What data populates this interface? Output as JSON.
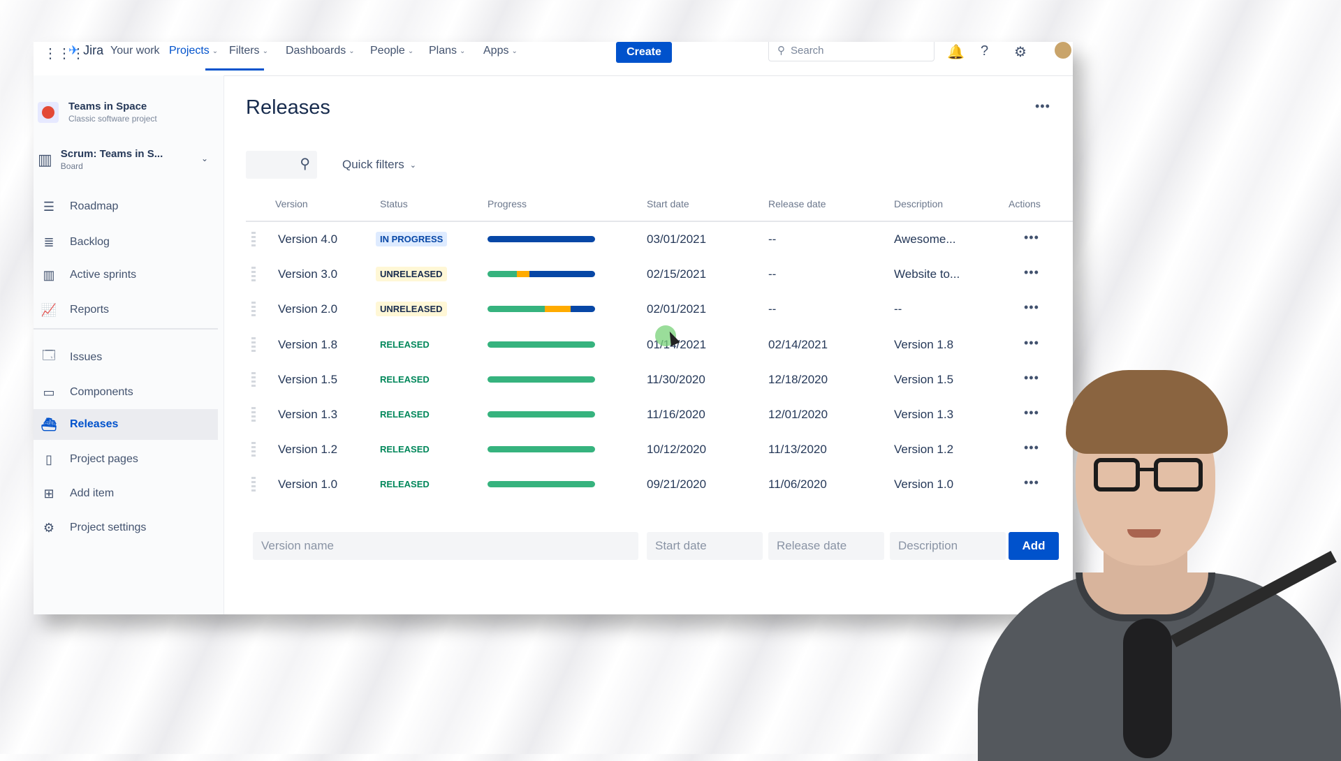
{
  "topnav": {
    "logo": "Jira",
    "items": [
      {
        "label": "Your work",
        "dropdown": false
      },
      {
        "label": "Projects",
        "dropdown": true,
        "active": true
      },
      {
        "label": "Filters",
        "dropdown": true
      },
      {
        "label": "Dashboards",
        "dropdown": true
      },
      {
        "label": "People",
        "dropdown": true
      },
      {
        "label": "Plans",
        "dropdown": true
      },
      {
        "label": "Apps",
        "dropdown": true
      }
    ],
    "create_label": "Create",
    "search_placeholder": "Search",
    "icons": [
      "notifications-icon",
      "help-icon",
      "settings-icon",
      "user-avatar"
    ]
  },
  "sidebar": {
    "project_name": "Teams in Space",
    "project_type": "Classic software project",
    "board_name": "Scrum: Teams in S...",
    "board_type": "Board",
    "items": [
      {
        "label": "Roadmap",
        "icon": "roadmap-icon"
      },
      {
        "label": "Backlog",
        "icon": "backlog-icon"
      },
      {
        "label": "Active sprints",
        "icon": "board-icon"
      },
      {
        "label": "Reports",
        "icon": "chart-icon"
      },
      {
        "label": "Issues",
        "icon": "issues-icon"
      },
      {
        "label": "Components",
        "icon": "components-icon"
      },
      {
        "label": "Releases",
        "icon": "ship-icon",
        "active": true
      },
      {
        "label": "Project pages",
        "icon": "page-icon"
      },
      {
        "label": "Add item",
        "icon": "add-item-icon"
      },
      {
        "label": "Project settings",
        "icon": "gear-icon"
      }
    ]
  },
  "main": {
    "title": "Releases",
    "quick_filters_label": "Quick filters",
    "columns": [
      "Version",
      "Status",
      "Progress",
      "Start date",
      "Release date",
      "Description",
      "Actions"
    ],
    "rows": [
      {
        "version": "Version 4.0",
        "status": "IN PROGRESS",
        "status_type": "progress",
        "progress": {
          "done": 0,
          "in_progress": 0,
          "todo": 1.0
        },
        "start": "03/01/2021",
        "release": "--",
        "description": "Awesome..."
      },
      {
        "version": "Version 3.0",
        "status": "UNRELEASED",
        "status_type": "unreleased",
        "progress": {
          "done": 0.27,
          "in_progress": 0.12,
          "todo": 0.61
        },
        "start": "02/15/2021",
        "release": "--",
        "description": "Website to..."
      },
      {
        "version": "Version 2.0",
        "status": "UNRELEASED",
        "status_type": "unreleased",
        "progress": {
          "done": 0.53,
          "in_progress": 0.24,
          "todo": 0.23
        },
        "start": "02/01/2021",
        "release": "--",
        "description": "--"
      },
      {
        "version": "Version 1.8",
        "status": "RELEASED",
        "status_type": "released",
        "progress": {
          "done": 1.0,
          "in_progress": 0,
          "todo": 0
        },
        "start": "01/14/2021",
        "release": "02/14/2021",
        "description": "Version 1.8"
      },
      {
        "version": "Version 1.5",
        "status": "RELEASED",
        "status_type": "released",
        "progress": {
          "done": 1.0,
          "in_progress": 0,
          "todo": 0
        },
        "start": "11/30/2020",
        "release": "12/18/2020",
        "description": "Version 1.5"
      },
      {
        "version": "Version 1.3",
        "status": "RELEASED",
        "status_type": "released",
        "progress": {
          "done": 1.0,
          "in_progress": 0,
          "todo": 0
        },
        "start": "11/16/2020",
        "release": "12/01/2020",
        "description": "Version 1.3"
      },
      {
        "version": "Version 1.2",
        "status": "RELEASED",
        "status_type": "released",
        "progress": {
          "done": 1.0,
          "in_progress": 0,
          "todo": 0
        },
        "start": "10/12/2020",
        "release": "11/13/2020",
        "description": "Version 1.2"
      },
      {
        "version": "Version 1.0",
        "status": "RELEASED",
        "status_type": "released",
        "progress": {
          "done": 1.0,
          "in_progress": 0,
          "todo": 0
        },
        "start": "09/21/2020",
        "release": "11/06/2020",
        "description": "Version 1.0"
      }
    ],
    "add_form": {
      "version_placeholder": "Version name",
      "start_placeholder": "Start date",
      "release_placeholder": "Release date",
      "description_placeholder": "Description",
      "add_label": "Add"
    }
  },
  "colors": {
    "accent": "#0052cc",
    "done": "#36b37e",
    "in_progress": "#ffab00",
    "todo": "#0747a6"
  }
}
